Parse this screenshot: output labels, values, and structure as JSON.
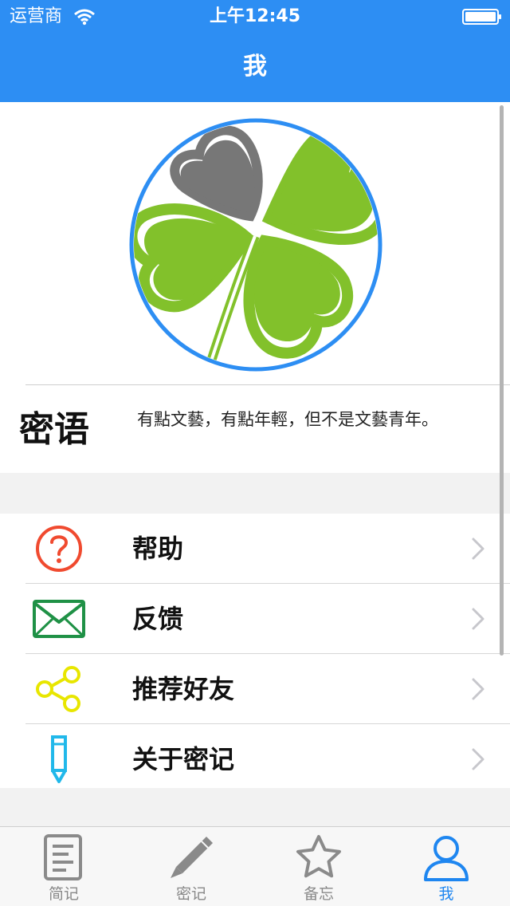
{
  "status_bar": {
    "carrier": "运营商",
    "time": "上午12:45"
  },
  "nav": {
    "title": "我"
  },
  "profile": {
    "motto_label": "密语",
    "motto_text": "有點文藝，有點年輕，但不是文藝青年。"
  },
  "menu": {
    "items": [
      {
        "label": "帮助",
        "icon": "help-icon"
      },
      {
        "label": "反馈",
        "icon": "mail-icon"
      },
      {
        "label": "推荐好友",
        "icon": "share-icon"
      },
      {
        "label": "关于密记",
        "icon": "pencil-icon"
      }
    ]
  },
  "tabs": [
    {
      "label": "简记",
      "icon": "document-icon"
    },
    {
      "label": "密记",
      "icon": "pencil-icon"
    },
    {
      "label": "备忘",
      "icon": "star-icon"
    },
    {
      "label": "我",
      "icon": "user-icon",
      "active": true
    }
  ],
  "colors": {
    "accent": "#2d8ef3",
    "help": "#f04a2f",
    "mail": "#1f9146",
    "share": "#e8e600",
    "pencil": "#21b8ea",
    "clover_green": "#82c12b",
    "clover_gray": "#777777"
  }
}
